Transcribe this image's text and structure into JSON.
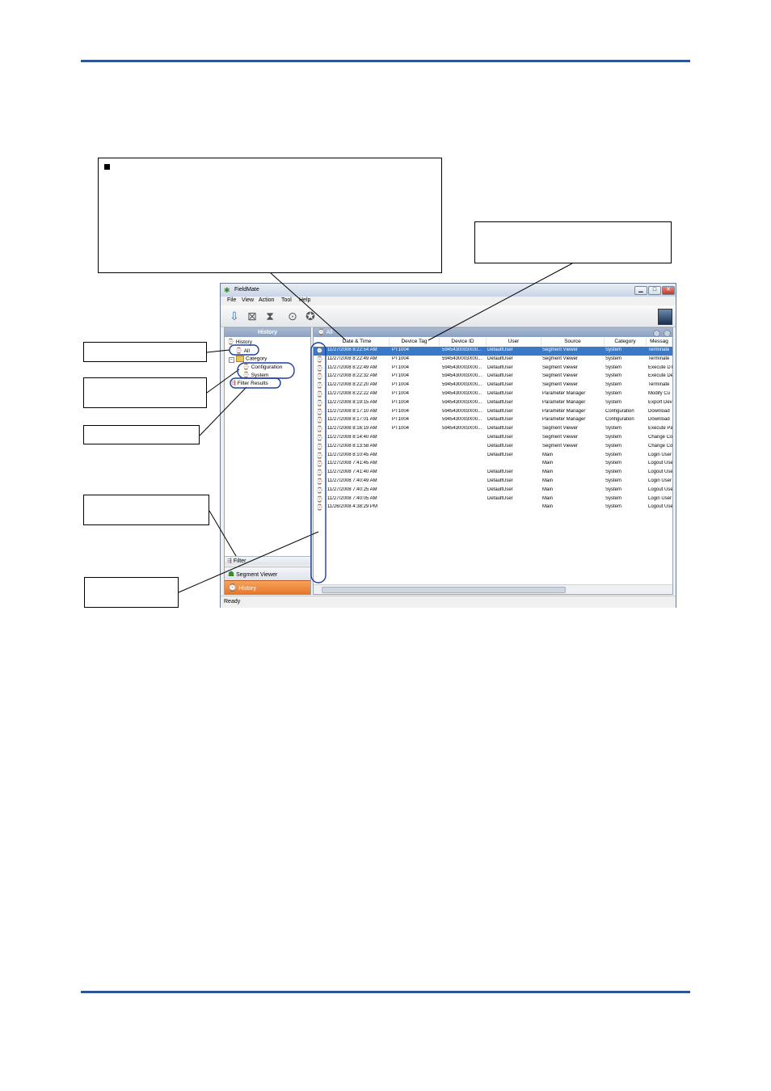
{
  "window": {
    "title": "FieldMate",
    "status": "Ready",
    "minimize_glyph": "▁",
    "maximize_glyph": "□",
    "close_glyph": "✕"
  },
  "menu": [
    "File",
    "View",
    "Action",
    "Tool",
    "Help"
  ],
  "toolbar_icons": [
    "open-icon",
    "delete-icon",
    "history-icon",
    "search-icon",
    "device-icon"
  ],
  "nav": {
    "header": "History",
    "tree": {
      "root": "History",
      "all": "All",
      "category": "Category",
      "configuration": "Configuration",
      "system": "System",
      "filter_results": "Filter Results"
    },
    "filter": "Filter",
    "segment_viewer": "Segment Viewer",
    "history": "History"
  },
  "grid": {
    "header": "All",
    "columns": [
      "Date & Time",
      "Device Tag",
      "Device ID",
      "User",
      "Source",
      "Category",
      "Messag"
    ],
    "rows": [
      [
        "11/27/2008 8:22:54 AM",
        "PT1004",
        "5945430003X00...",
        "DefaultUser",
        "Segment Viewer",
        "System",
        "Terminate"
      ],
      [
        "11/27/2008 8:22:49 AM",
        "PT1004",
        "5945430003X00...",
        "DefaultUser",
        "Segment Viewer",
        "System",
        "Terminate"
      ],
      [
        "11/27/2008 8:22:49 AM",
        "PT1004",
        "5945430003X00...",
        "DefaultUser",
        "Segment Viewer",
        "System",
        "Execute DT"
      ],
      [
        "11/27/2008 8:22:32 AM",
        "PT1004",
        "5945430003X00...",
        "DefaultUser",
        "Segment Viewer",
        "System",
        "Execute De"
      ],
      [
        "11/27/2008 8:22:20 AM",
        "PT1004",
        "5945430003X00...",
        "DefaultUser",
        "Segment Viewer",
        "System",
        "Terminate"
      ],
      [
        "11/27/2008 8:22:22 AM",
        "PT1004",
        "5945430003X00...",
        "DefaultUser",
        "Parameter Manager",
        "System",
        "Modify Cu"
      ],
      [
        "11/27/2008 8:19:15 AM",
        "PT1004",
        "5945430003X00...",
        "DefaultUser",
        "Parameter Manager",
        "System",
        "Export Dev"
      ],
      [
        "11/27/2008 8:17:10 AM",
        "PT1004",
        "5945430003X00...",
        "DefaultUser",
        "Parameter Manager",
        "Configuration",
        "Download"
      ],
      [
        "11/27/2008 8:17:01 AM",
        "PT1004",
        "5945430003X00...",
        "DefaultUser",
        "Parameter Manager",
        "Configuration",
        "Download"
      ],
      [
        "11/27/2008 8:16:19 AM",
        "PT1004",
        "5945430003X00...",
        "DefaultUser",
        "Segment Viewer",
        "System",
        "Execute Pa"
      ],
      [
        "11/27/2008 8:14:40 AM",
        "",
        "",
        "DefaultUser",
        "Segment Viewer",
        "System",
        "Change Co"
      ],
      [
        "11/27/2008 8:13:58 AM",
        "",
        "",
        "DefaultUser",
        "Segment Viewer",
        "System",
        "Change Co"
      ],
      [
        "11/27/2008 8:10:45 AM",
        "",
        "",
        "DefaultUser",
        "Main",
        "System",
        "Login User"
      ],
      [
        "11/27/2008 7:41:45 AM",
        "",
        "",
        "",
        "Main",
        "System",
        "Logout Use"
      ],
      [
        "11/27/2008 7:41:40 AM",
        "",
        "",
        "DefaultUser",
        "Main",
        "System",
        "Logout Use"
      ],
      [
        "11/27/2008 7:40:49 AM",
        "",
        "",
        "DefaultUser",
        "Main",
        "System",
        "Login User"
      ],
      [
        "11/27/2008 7:40:25 AM",
        "",
        "",
        "DefaultUser",
        "Main",
        "System",
        "Logout Use"
      ],
      [
        "11/27/2008 7:40:05 AM",
        "",
        "",
        "DefaultUser",
        "Main",
        "System",
        "Login User"
      ],
      [
        "11/26/2008 4:38:29 PM",
        "",
        "",
        "",
        "Main",
        "System",
        "Logout Use"
      ]
    ]
  },
  "colors": {
    "rule": "#2f5597",
    "selection": "#3a78c8",
    "callout_oval": "#1f3fa0",
    "history_tab": "#e4742a"
  }
}
